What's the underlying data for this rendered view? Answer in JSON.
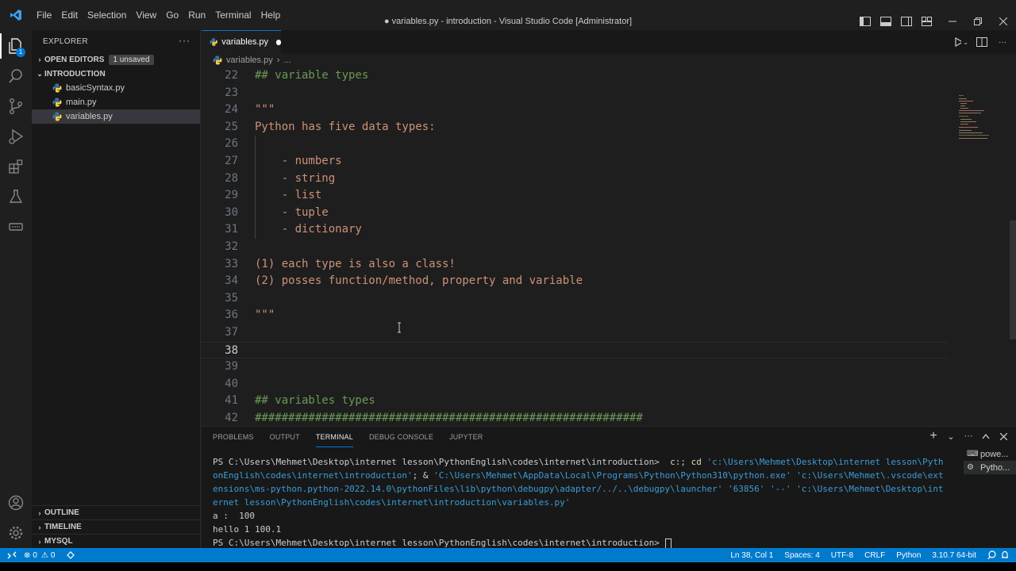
{
  "window": {
    "title": "● variables.py - introduction - Visual Studio Code [Administrator]",
    "menu": [
      "File",
      "Edit",
      "Selection",
      "View",
      "Go",
      "Run",
      "Terminal",
      "Help"
    ]
  },
  "activity_bar": {
    "explorer_badge": "1"
  },
  "sidebar": {
    "header": "EXPLORER",
    "more": "···",
    "open_editors_label": "OPEN EDITORS",
    "unsaved_badge": "1 unsaved",
    "folder_label": "INTRODUCTION",
    "files": [
      {
        "name": "basicSyntax.py"
      },
      {
        "name": "main.py"
      },
      {
        "name": "variables.py"
      }
    ],
    "outline_label": "OUTLINE",
    "timeline_label": "TIMELINE",
    "mysql_label": "MYSQL"
  },
  "editor": {
    "tab_label": "variables.py",
    "breadcrumb_file": "variables.py",
    "breadcrumb_more": "...",
    "lines": [
      {
        "num": "22",
        "text": "## variable types",
        "kind": "comment"
      },
      {
        "num": "23",
        "text": "",
        "kind": "string"
      },
      {
        "num": "24",
        "text": "\"\"\"",
        "kind": "string"
      },
      {
        "num": "25",
        "text": "Python has five data types:",
        "kind": "string"
      },
      {
        "num": "26",
        "text": "",
        "kind": "string"
      },
      {
        "num": "27",
        "text": "    - numbers",
        "kind": "string"
      },
      {
        "num": "28",
        "text": "    - string",
        "kind": "string"
      },
      {
        "num": "29",
        "text": "    - list",
        "kind": "string"
      },
      {
        "num": "30",
        "text": "    - tuple",
        "kind": "string"
      },
      {
        "num": "31",
        "text": "    - dictionary",
        "kind": "string"
      },
      {
        "num": "32",
        "text": "",
        "kind": "string"
      },
      {
        "num": "33",
        "text": "(1) each type is also a class!",
        "kind": "string"
      },
      {
        "num": "34",
        "text": "(2) posses function/method, property and variable",
        "kind": "string"
      },
      {
        "num": "35",
        "text": "",
        "kind": "string"
      },
      {
        "num": "36",
        "text": "\"\"\"",
        "kind": "string"
      },
      {
        "num": "37",
        "text": "",
        "kind": "string"
      },
      {
        "num": "38",
        "text": "",
        "kind": "string"
      },
      {
        "num": "39",
        "text": "",
        "kind": "string"
      },
      {
        "num": "40",
        "text": "",
        "kind": "string"
      },
      {
        "num": "41",
        "text": "## variables types",
        "kind": "comment"
      },
      {
        "num": "42",
        "text": "##########################################################",
        "kind": "comment"
      }
    ],
    "current_line": "38"
  },
  "panel": {
    "tabs": [
      "PROBLEMS",
      "OUTPUT",
      "TERMINAL",
      "DEBUG CONSOLE",
      "JUPYTER"
    ],
    "active_tab": "TERMINAL",
    "terminal_lines": [
      [
        {
          "t": "PS C:\\Users\\Mehmet\\Desktop\\internet lesson\\PythonEnglish\\codes\\internet\\introduction>  ",
          "c": "path"
        },
        {
          "t": "c:",
          "c": "cmd"
        },
        {
          "t": "; ",
          "c": "path"
        },
        {
          "t": "cd",
          "c": "cmd"
        },
        {
          "t": " 'c:\\Users\\Mehmet\\Desktop\\internet lesson\\Pyth",
          "c": "str"
        }
      ],
      [
        {
          "t": "onEnglish\\codes\\internet\\introduction'",
          "c": "str"
        },
        {
          "t": "; & ",
          "c": "path"
        },
        {
          "t": "'C:\\Users\\Mehmet\\AppData\\Local\\Programs\\Python\\Python310\\python.exe' 'c:\\Users\\Mehmet\\.vscode\\ext",
          "c": "str"
        }
      ],
      [
        {
          "t": "ensions\\ms-python.python-2022.14.0\\pythonFiles\\lib\\python\\debugpy\\adapter/../..\\debugpy\\launcher' '63856' '--' 'c:\\Users\\Mehmet\\Desktop\\int",
          "c": "str"
        }
      ],
      [
        {
          "t": "ernet lesson\\PythonEnglish\\codes\\internet\\introduction\\variables.py'",
          "c": "str"
        }
      ],
      [
        {
          "t": "a :  100",
          "c": "path"
        }
      ],
      [
        {
          "t": "hello 1 100.1",
          "c": "path"
        }
      ],
      [
        {
          "t": "PS C:\\Users\\Mehmet\\Desktop\\internet lesson\\PythonEnglish\\codes\\internet\\introduction> ",
          "c": "path"
        }
      ]
    ],
    "terminal_instances": [
      {
        "label": "powe..."
      },
      {
        "label": "Pytho..."
      }
    ]
  },
  "statusbar": {
    "errors": "0",
    "warnings": "0",
    "position": "Ln 38, Col 1",
    "spaces": "Spaces: 4",
    "encoding": "UTF-8",
    "eol": "CRLF",
    "language": "Python",
    "interpreter": "3.10.7 64-bit"
  },
  "colors": {
    "accent": "#007acc",
    "string": "#ce9178",
    "comment": "#6a9955"
  }
}
